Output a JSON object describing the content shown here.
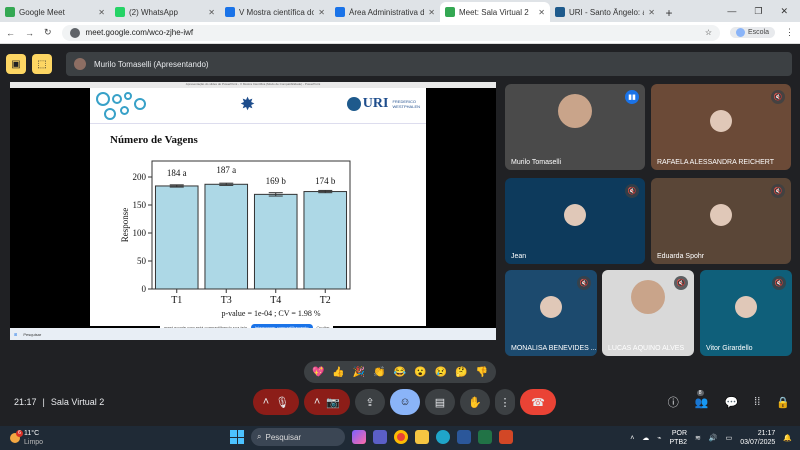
{
  "browser": {
    "tabs": [
      {
        "label": "Google Meet",
        "color": "#34a853",
        "active": false
      },
      {
        "label": "(2) WhatsApp",
        "color": "#25d366",
        "active": false
      },
      {
        "label": "V Mostra científica do DCA",
        "color": "#1a73e8",
        "active": false
      },
      {
        "label": "Área Administrativa da V M",
        "color": "#1a73e8",
        "active": false
      },
      {
        "label": "Meet: Sala Virtual 2",
        "color": "#34a853",
        "active": true
      },
      {
        "label": "URI - Santo Ângelo: agen",
        "color": "#1e5a8c",
        "active": false
      }
    ],
    "new_tab": "+",
    "url": "meet.google.com/wco-zjhe-iwf",
    "profile": "Escola"
  },
  "meet": {
    "presenter_label": "Murilo Tomaselli (Apresentando)",
    "meeting_time": "21:17",
    "meeting_separator": "|",
    "meeting_name": "Sala Virtual 2",
    "people_badge": "8",
    "reactions": [
      "💖",
      "👍",
      "🎉",
      "👏",
      "😂",
      "😮",
      "😢",
      "🤔",
      "👎"
    ],
    "participants": [
      {
        "name": "Murilo Tomaselli",
        "muted": false,
        "bg": "#4a4a4a"
      },
      {
        "name": "RAFAELA ALESSANDRA REICHERT",
        "muted": true,
        "bg": "#6b4a37"
      },
      {
        "name": "Jean",
        "muted": true,
        "bg": "#0d3a5c"
      },
      {
        "name": "Eduarda Spohr",
        "muted": true,
        "bg": "#5a4637"
      },
      {
        "name": "MONALISA BENEVIDES ...",
        "muted": true,
        "bg": "#1c4a6e"
      },
      {
        "name": "LUCAS AQUINO ALVES",
        "muted": true,
        "bg": "#d9d9d9"
      },
      {
        "name": "Vitor Girardello",
        "muted": true,
        "bg": "#0f5f7a"
      }
    ]
  },
  "slide": {
    "window_title": "Apresentação do slides do PowerPoint - V Mostra Científica (Modo de Compatibilidade) - PowerPoint",
    "logo_caption": "",
    "uri_text": "URI",
    "uri_sub1": "FREDERICO",
    "uri_sub2": "WESTPHALEN",
    "title": "Número de Vagens",
    "stats_text": "p-value = 1e-04 ; CV =  1.98 %",
    "share_notice": "meet.google.com está compartilhando sua tela",
    "share_stop": "Interromper compartilhamento",
    "share_hide": "Ocultar",
    "mini_search": "Pesquisar"
  },
  "chart_data": {
    "type": "bar",
    "title": "Número de Vagens",
    "xlabel": "",
    "ylabel": "Response",
    "categories": [
      "T1",
      "T3",
      "T4",
      "T2"
    ],
    "values": [
      184,
      187,
      169,
      174
    ],
    "errors": [
      2,
      2,
      3,
      2
    ],
    "data_labels": [
      "184 a",
      "187 a",
      "169 b",
      "174 b"
    ],
    "ylim": [
      0,
      200
    ],
    "yticks": [
      0,
      50,
      100,
      150,
      200
    ],
    "bar_color": "#add8e6",
    "annotation": "p-value = 1e-04 ; CV =  1.98 %"
  },
  "taskbar": {
    "weather_temp": "11°C",
    "weather_desc": "Limpo",
    "weather_badge": "6",
    "search": "Pesquisar",
    "lang1": "POR",
    "lang2": "PTB2",
    "time": "21:17",
    "date": "03/07/2025"
  }
}
